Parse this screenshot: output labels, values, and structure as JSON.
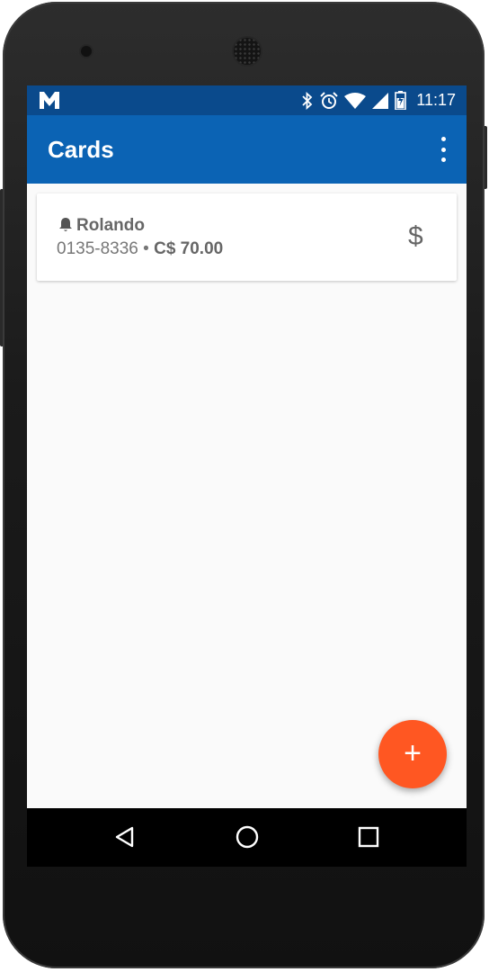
{
  "status_bar": {
    "time": "11:17",
    "app_icon": "m-logo-icon",
    "icons": [
      "bluetooth-icon",
      "alarm-icon",
      "wifi-icon",
      "cell-signal-icon",
      "battery-icon"
    ]
  },
  "toolbar": {
    "title": "Cards",
    "menu_icon": "more-vert-icon"
  },
  "card": {
    "name": "Rolando",
    "number": "0135-8336",
    "separator": " • ",
    "amount": "C$ 70.00",
    "action_icon": "$"
  },
  "fab": {
    "label": "+"
  },
  "nav": [
    "back-icon",
    "home-icon",
    "recents-icon"
  ],
  "colors": {
    "status_bar": "#0a4a8c",
    "toolbar": "#0b63b4",
    "fab": "#ff5722",
    "background": "#fafafa"
  }
}
